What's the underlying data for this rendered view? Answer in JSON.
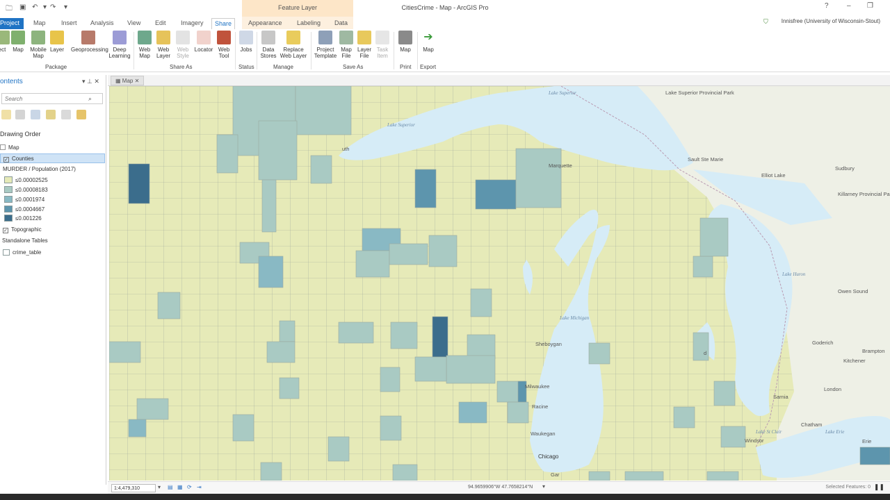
{
  "window": {
    "title": "CitiesCrime - Map - ArcGIS Pro",
    "context_group": "Feature Layer",
    "signin": "Innisfree (University of Wisconsin-Stout)",
    "help": "?",
    "minimize": "–",
    "restore": "❐"
  },
  "tabs": [
    {
      "label": "Project"
    },
    {
      "label": "Map"
    },
    {
      "label": "Insert"
    },
    {
      "label": "Analysis"
    },
    {
      "label": "View"
    },
    {
      "label": "Edit"
    },
    {
      "label": "Imagery"
    },
    {
      "label": "Share"
    },
    {
      "label": "Appearance"
    },
    {
      "label": "Labeling"
    },
    {
      "label": "Data"
    }
  ],
  "ribbon": {
    "buttons": [
      {
        "label": "ect"
      },
      {
        "label": "Map"
      },
      {
        "label": "Mobile Map"
      },
      {
        "label": "Layer"
      },
      {
        "label": "Geoprocessing"
      },
      {
        "label": "Deep Learning"
      },
      {
        "label": "Web Map"
      },
      {
        "label": "Web Layer"
      },
      {
        "label": "Web Style"
      },
      {
        "label": "Locator"
      },
      {
        "label": "Web Tool"
      },
      {
        "label": "Jobs"
      },
      {
        "label": "Data Stores"
      },
      {
        "label": "Replace Web Layer"
      },
      {
        "label": "Project Template"
      },
      {
        "label": "Map File"
      },
      {
        "label": "Layer File"
      },
      {
        "label": "Task Item"
      },
      {
        "label": "Map"
      },
      {
        "label": "Map"
      }
    ],
    "groups": [
      "Package",
      "Share As",
      "Status",
      "Manage",
      "Save As",
      "Print",
      "Export"
    ]
  },
  "contents": {
    "title": "ontents",
    "search_placeholder": "Search",
    "drawing_order": "Drawing Order",
    "map_item": "Map",
    "counties_layer": "Counties",
    "legend_title": "MURDER / Population (2017)",
    "legend": [
      {
        "label": "≤0.00002525",
        "color": "#e6eab8"
      },
      {
        "label": "≤0.00008183",
        "color": "#a9cac3"
      },
      {
        "label": "≤0.0001974",
        "color": "#89b9c4"
      },
      {
        "label": "≤0.0004667",
        "color": "#5d95ad"
      },
      {
        "label": "≤0.001226",
        "color": "#3b6d8c"
      }
    ],
    "topographic_layer": "Topographic",
    "standalone_tables": "Standalone Tables",
    "crime_table": "crime_table"
  },
  "map": {
    "tab_label": "Map",
    "scale": "1:4,479,310",
    "coordinates": "94.9659906°W 47.7658214°N",
    "selected_features": "Selected Features: 0",
    "labels": {
      "lake_superior_1": "Lake Superior",
      "lake_superior_2": "Lake Superior",
      "lake_superior_3": "Lake Superior Provincial Park",
      "lake_michigan": "Lake Michigan",
      "lake_huron": "Lake Huron",
      "lake_erie": "Lake Erie",
      "lake_st_clair": "Lake St Clair",
      "killarney": "Killarney Provincial Park",
      "duluth": "uth",
      "marquette": "Marquette",
      "sault": "Sault Ste Marie",
      "elliot_lake": "Elliot Lake",
      "sudbury": "Sudbury",
      "owen_sound": "Owen Sound",
      "sheboygan": "Sheboygan",
      "milwaukee": "Milwaukee",
      "racine": "Racine",
      "waukegan": "Waukegan",
      "chicago": "Chicago",
      "gary": "Gar",
      "goderich": "Goderich",
      "kitchener": "Kitchener",
      "brampton": "Brampton",
      "london": "London",
      "sarnia": "Sarnia",
      "chatham": "Chatham",
      "windsor": "Windsor",
      "erie": "Erie",
      "detroit_partial": "d"
    }
  }
}
